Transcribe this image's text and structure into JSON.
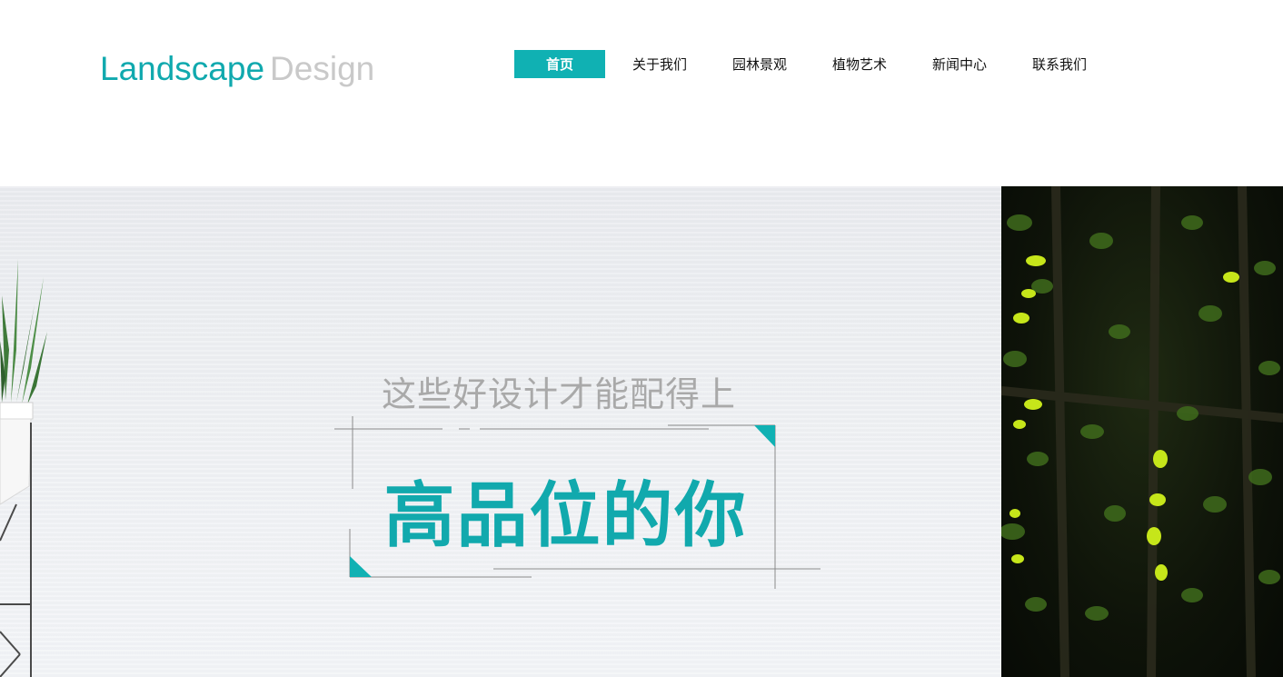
{
  "logo": {
    "word1": "Landscape",
    "word2": "Design"
  },
  "nav": {
    "items": [
      {
        "label": "首页",
        "active": true
      },
      {
        "label": "关于我们"
      },
      {
        "label": "园林景观"
      },
      {
        "label": "植物艺术"
      },
      {
        "label": "新闻中心"
      },
      {
        "label": "联系我们"
      }
    ]
  },
  "hero": {
    "subtitle": "这些好设计才能配得上",
    "title": "高品位的你"
  },
  "colors": {
    "accent": "#10b1b3",
    "logo_secondary": "#c9c9c9",
    "subtitle": "#a9a9a9"
  }
}
